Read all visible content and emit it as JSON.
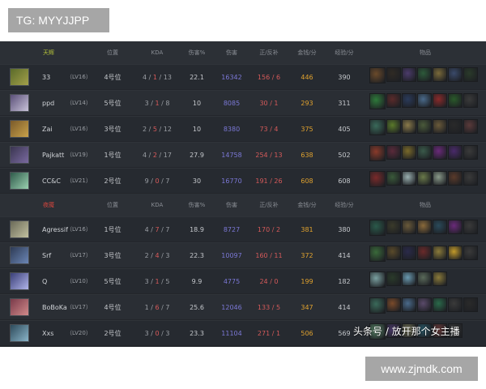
{
  "watermark_top": "TG: MYYJJPP",
  "watermark_bottom": "www.zjmdk.com",
  "overlay_caption": "头条号 / 放开那个女主播",
  "colors": {
    "radiant": "#b7c53a",
    "dire": "#d8463e",
    "damage": "#7b78d6",
    "lasthit": "#d55a5a",
    "gold": "#e0a22e",
    "kda_death": "#d85a5a",
    "kda_green": "#7bbf58"
  },
  "radiant_header": {
    "team": "天辉",
    "pos": "位置",
    "kda": "KDA",
    "dmgpct": "伤害%",
    "dmg": "伤害",
    "lh": "正/反补",
    "gpm": "金钱/分",
    "xpm": "经验/分",
    "items": "物品"
  },
  "dire_header": {
    "team": "夜魇",
    "pos": "位置",
    "kda": "KDA",
    "dmgpct": "伤害%",
    "dmg": "伤害",
    "lh": "正/反补",
    "gpm": "金钱/分",
    "xpm": "经验/分",
    "items": "物品"
  },
  "radiant": [
    {
      "name": "33",
      "lvl": "（LV16）",
      "pos": "4号位",
      "k": "4",
      "d": "1",
      "a": "13",
      "pct": "22.1",
      "dmg": "16342",
      "lh": "156 / 6",
      "gpm": "446",
      "xpm": "390"
    },
    {
      "name": "ppd",
      "lvl": "（LV14）",
      "pos": "5号位",
      "k": "3",
      "d": "1",
      "a": "8",
      "pct": "10",
      "dmg": "8085",
      "lh": "30 / 1",
      "gpm": "293",
      "xpm": "311"
    },
    {
      "name": "Zai",
      "lvl": "（LV16）",
      "pos": "3号位",
      "k": "2",
      "d": "5",
      "a": "12",
      "pct": "10",
      "dmg": "8380",
      "lh": "73 / 4",
      "gpm": "375",
      "xpm": "405"
    },
    {
      "name": "Pajkatt",
      "lvl": "（LV19）",
      "pos": "1号位",
      "k": "4",
      "d": "2",
      "a": "17",
      "pct": "27.9",
      "dmg": "14758",
      "lh": "254 / 13",
      "gpm": "638",
      "xpm": "502"
    },
    {
      "name": "CC&C",
      "lvl": "（LV21）",
      "pos": "2号位",
      "k": "9",
      "d": "0",
      "a": "7",
      "pct": "30",
      "dmg": "16770",
      "lh": "191 / 26",
      "gpm": "608",
      "xpm": "608"
    }
  ],
  "dire": [
    {
      "name": "Agressif",
      "lvl": "（LV16）",
      "pos": "1号位",
      "k": "4",
      "d": "7",
      "a": "7",
      "pct": "18.9",
      "dmg": "8727",
      "lh": "170 / 2",
      "gpm": "381",
      "xpm": "380"
    },
    {
      "name": "Srf",
      "lvl": "（LV17）",
      "pos": "3号位",
      "k": "2",
      "d": "4",
      "a": "3",
      "pct": "22.3",
      "dmg": "10097",
      "lh": "160 / 11",
      "gpm": "372",
      "xpm": "414"
    },
    {
      "name": "Q",
      "lvl": "（LV10）",
      "pos": "5号位",
      "k": "3",
      "d": "1",
      "a": "5",
      "pct": "9.9",
      "dmg": "4775",
      "lh": "24 / 0",
      "gpm": "199",
      "xpm": "182"
    },
    {
      "name": "BoBoKa",
      "lvl": "（LV17）",
      "pos": "4号位",
      "k": "1",
      "d": "6",
      "a": "7",
      "pct": "25.6",
      "dmg": "12046",
      "lh": "133 / 5",
      "gpm": "347",
      "xpm": "414"
    },
    {
      "name": "Xxs",
      "lvl": "（LV20）",
      "pos": "2号位",
      "k": "3",
      "d": "0",
      "a": "3",
      "pct": "23.3",
      "dmg": "11104",
      "lh": "271 / 1",
      "gpm": "506",
      "xpm": "569"
    }
  ]
}
